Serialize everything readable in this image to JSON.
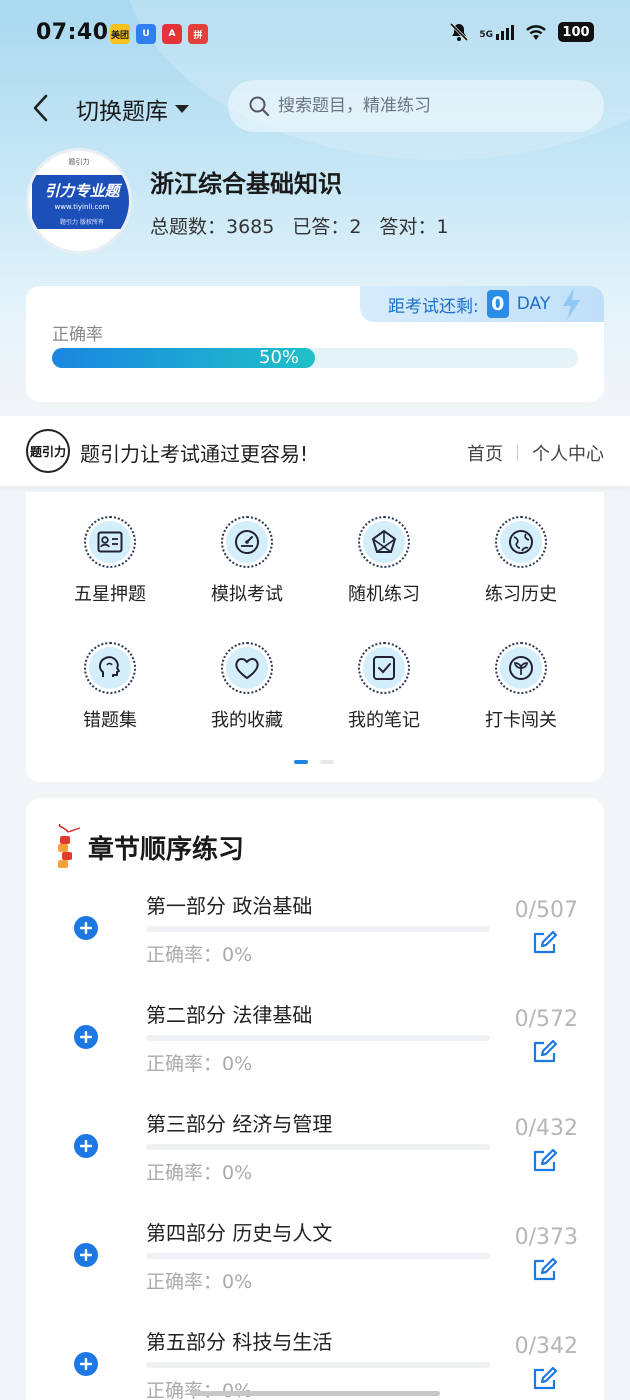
{
  "status_bar": {
    "time": "07:40",
    "app_icons": [
      "美团",
      "U",
      "A",
      "拼"
    ],
    "network": "5G",
    "battery": "100"
  },
  "header": {
    "switch_label": "切换题库",
    "search_placeholder": "搜索题目，精准练习"
  },
  "bank": {
    "logo_text": "引力专业题",
    "logo_url": "www.tiyinli.com",
    "logo_sub": "题引力 版权所有",
    "logo_top": "题引力",
    "title": "浙江综合基础知识",
    "total_label": "总题数：3685",
    "answered_label": "已答：2",
    "correct_label": "答对：1"
  },
  "accuracy": {
    "label": "正确率",
    "percent_text": "50%",
    "fraction": 0.5,
    "countdown_label": "距考试还剩:",
    "days": "0",
    "day_unit": "DAY"
  },
  "slogan": {
    "logo": "题引力",
    "text": "题引力让考试通过更容易!",
    "nav": [
      "首页",
      "个人中心"
    ]
  },
  "features": [
    {
      "label": "五星押题",
      "icon": "id-card-icon"
    },
    {
      "label": "模拟考试",
      "icon": "speedometer-icon"
    },
    {
      "label": "随机练习",
      "icon": "network-icon"
    },
    {
      "label": "练习历史",
      "icon": "globe-icon"
    },
    {
      "label": "错题集",
      "icon": "brain-icon"
    },
    {
      "label": "我的收藏",
      "icon": "heart-icon"
    },
    {
      "label": "我的笔记",
      "icon": "note-check-icon"
    },
    {
      "label": "打卡闯关",
      "icon": "sprout-icon"
    }
  ],
  "chapters": {
    "title": "章节顺序练习",
    "items": [
      {
        "name": "第一部分 政治基础",
        "accuracy": "正确率：0%",
        "count": "0/507"
      },
      {
        "name": "第二部分 法律基础",
        "accuracy": "正确率：0%",
        "count": "0/572"
      },
      {
        "name": "第三部分 经济与管理",
        "accuracy": "正确率：0%",
        "count": "0/432"
      },
      {
        "name": "第四部分 历史与人文",
        "accuracy": "正确率：0%",
        "count": "0/373"
      },
      {
        "name": "第五部分 科技与生活",
        "accuracy": "正确率：0%",
        "count": "0/342"
      }
    ]
  },
  "colors": {
    "accent": "#1d78e4",
    "progress_start": "#1b86e0",
    "progress_end": "#1fc0c8"
  }
}
